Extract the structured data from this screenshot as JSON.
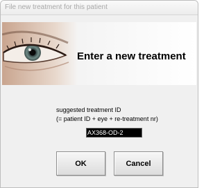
{
  "window": {
    "title": "File new treatment for this patient"
  },
  "banner": {
    "heading": "Enter a new treatment"
  },
  "form": {
    "label_line1": "suggested treatment ID",
    "label_line2": "(= patient ID + eye + re-treatment nr)",
    "treatment_id_value": "AX368-OD-2"
  },
  "buttons": {
    "ok_label": "OK",
    "cancel_label": "Cancel"
  },
  "colors": {
    "window_bg": "#f0f0f0",
    "field_bg": "#000000",
    "field_text": "#ffffff"
  },
  "icons": {
    "banner_image": "eye-close-up-image"
  }
}
